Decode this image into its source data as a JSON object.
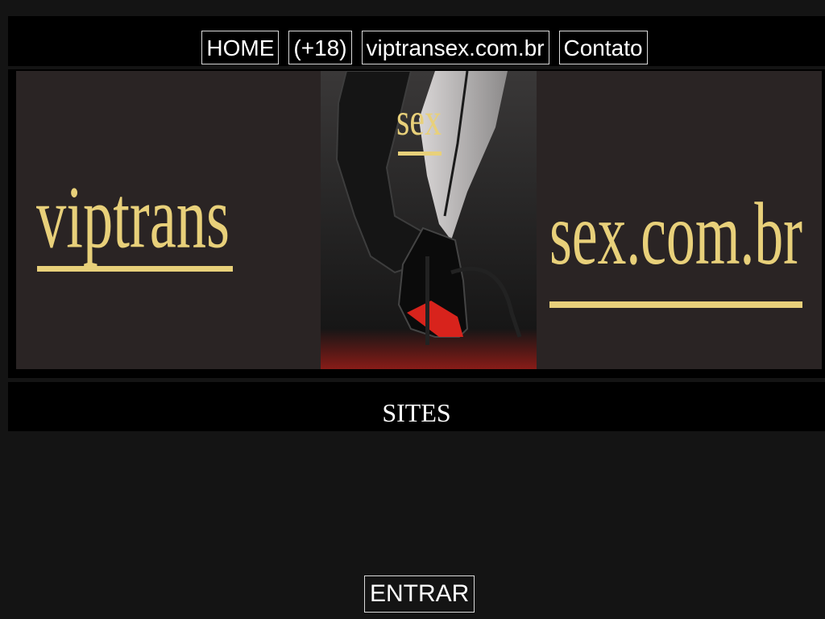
{
  "nav": {
    "items": [
      {
        "label": "HOME"
      },
      {
        "label": "(+18)"
      },
      {
        "label": "viptransex.com.br"
      },
      {
        "label": "Contato"
      }
    ]
  },
  "banner": {
    "left_text": "viptrans",
    "center_text": "sex",
    "right_text": "sex.com.br",
    "text_color": "#e8d07a",
    "background_color": "#2a2424"
  },
  "sites": {
    "title": "SITES"
  },
  "enter": {
    "label": "ENTRAR"
  },
  "colors": {
    "page_background": "#141414",
    "bar_background": "#000000",
    "text": "#ffffff",
    "accent_red": "#d8231c"
  }
}
